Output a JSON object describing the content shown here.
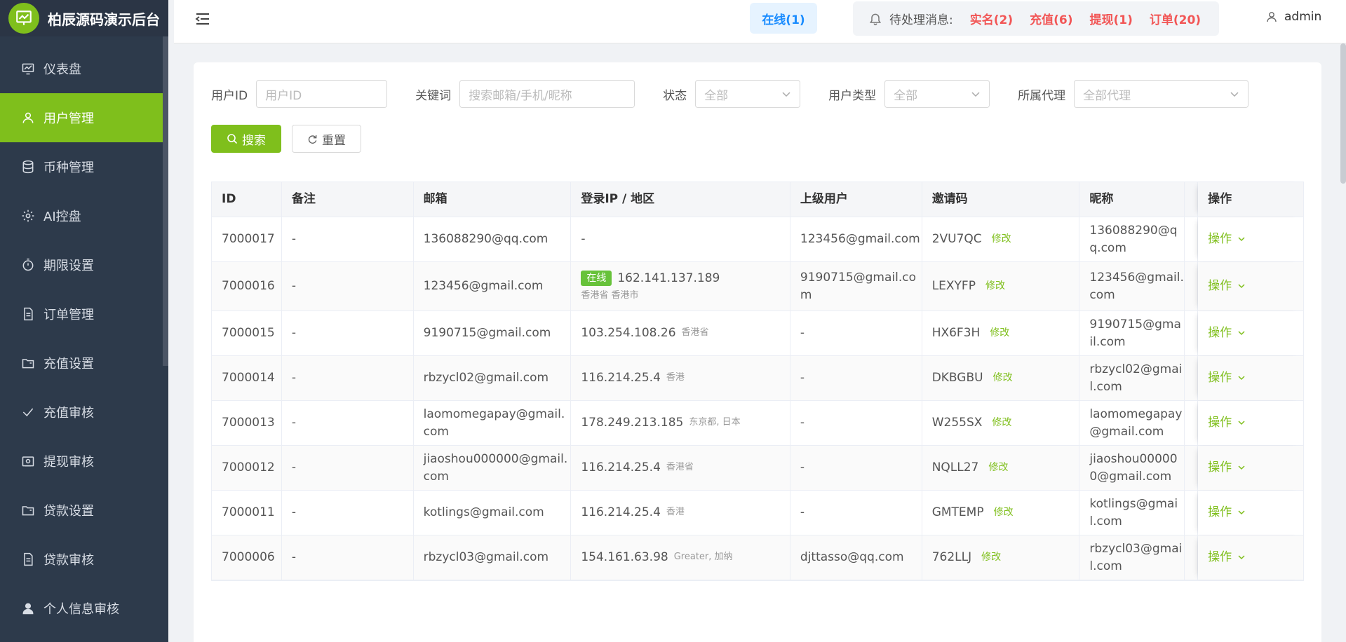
{
  "brand": {
    "title": "柏辰源码演示后台"
  },
  "sidebar": {
    "items": [
      {
        "label": "仪表盘",
        "icon": "dashboard-icon",
        "active": false
      },
      {
        "label": "用户管理",
        "icon": "user-icon",
        "active": true
      },
      {
        "label": "币种管理",
        "icon": "database-icon",
        "active": false
      },
      {
        "label": "AI控盘",
        "icon": "gear-icon",
        "active": false
      },
      {
        "label": "期限设置",
        "icon": "timer-icon",
        "active": false
      },
      {
        "label": "订单管理",
        "icon": "document-icon",
        "active": false
      },
      {
        "label": "充值设置",
        "icon": "folder-icon",
        "active": false
      },
      {
        "label": "充值审核",
        "icon": "check-icon",
        "active": false
      },
      {
        "label": "提现审核",
        "icon": "wallet-icon",
        "active": false
      },
      {
        "label": "贷款设置",
        "icon": "folder-icon",
        "active": false
      },
      {
        "label": "贷款审核",
        "icon": "document-icon",
        "active": false
      },
      {
        "label": "个人信息审核",
        "icon": "person-icon",
        "active": false
      }
    ]
  },
  "header": {
    "online": "在线(1)",
    "pending_label": "待处理消息:",
    "pending": [
      "实名(2)",
      "充值(6)",
      "提现(1)",
      "订单(20)"
    ],
    "user": "admin"
  },
  "filters": {
    "user_id_label": "用户ID",
    "user_id_placeholder": "用户ID",
    "keyword_label": "关键词",
    "keyword_placeholder": "搜索邮箱/手机/昵称",
    "status_label": "状态",
    "status_value": "全部",
    "type_label": "用户类型",
    "type_value": "全部",
    "agent_label": "所属代理",
    "agent_value": "全部代理"
  },
  "buttons": {
    "search": "搜索",
    "reset": "重置"
  },
  "table": {
    "headers": [
      "ID",
      "备注",
      "邮箱",
      "登录IP / 地区",
      "上级用户",
      "邀请码",
      "昵称",
      "",
      "操作"
    ],
    "edit_label": "修改",
    "op_label": "操作",
    "online_tag": "在线",
    "rows": [
      {
        "id": "7000017",
        "remark": "-",
        "email": "136088290@qq.com",
        "ip": "-",
        "region": "",
        "online": false,
        "parent": "123456@gmail.com",
        "code": "2VU7QC",
        "nick": "136088290@qq.com"
      },
      {
        "id": "7000016",
        "remark": "-",
        "email": "123456@gmail.com",
        "ip": "162.141.137.189",
        "region": "香港省 香港市",
        "online": true,
        "parent": "9190715@gmail.com",
        "code": "LEXYFP",
        "nick": "123456@gmail.com"
      },
      {
        "id": "7000015",
        "remark": "-",
        "email": "9190715@gmail.com",
        "ip": "103.254.108.26",
        "region": "香港省",
        "online": false,
        "parent": "-",
        "code": "HX6F3H",
        "nick": "9190715@gmail.com"
      },
      {
        "id": "7000014",
        "remark": "-",
        "email": "rbzycl02@gmail.com",
        "ip": "116.214.25.4",
        "region": "香港",
        "online": false,
        "parent": "-",
        "code": "DKBGBU",
        "nick": "rbzycl02@gmail.com"
      },
      {
        "id": "7000013",
        "remark": "-",
        "email": "laomomegapay@gmail.com",
        "ip": "178.249.213.185",
        "region": "东京都, 日本",
        "online": false,
        "parent": "-",
        "code": "W255SX",
        "nick": "laomomegapay@gmail.com"
      },
      {
        "id": "7000012",
        "remark": "-",
        "email": "jiaoshou000000@gmail.com",
        "ip": "116.214.25.4",
        "region": "香港省",
        "online": false,
        "parent": "-",
        "code": "NQLL27",
        "nick": "jiaoshou000000@gmail.com"
      },
      {
        "id": "7000011",
        "remark": "-",
        "email": "kotlings@gmail.com",
        "ip": "116.214.25.4",
        "region": "香港",
        "online": false,
        "parent": "-",
        "code": "GMTEMP",
        "nick": "kotlings@gmail.com"
      },
      {
        "id": "7000006",
        "remark": "-",
        "email": "rbzycl03@gmail.com",
        "ip": "154.161.63.98",
        "region": "Greater, 加纳",
        "online": false,
        "parent": "djttasso@qq.com",
        "code": "762LLJ",
        "nick": "rbzycl03@gmail.com"
      }
    ]
  },
  "colors": {
    "accent": "#7fbf1c",
    "sidebar": "#2d3a4b",
    "danger": "#f25656",
    "info": "#1a8cff"
  }
}
